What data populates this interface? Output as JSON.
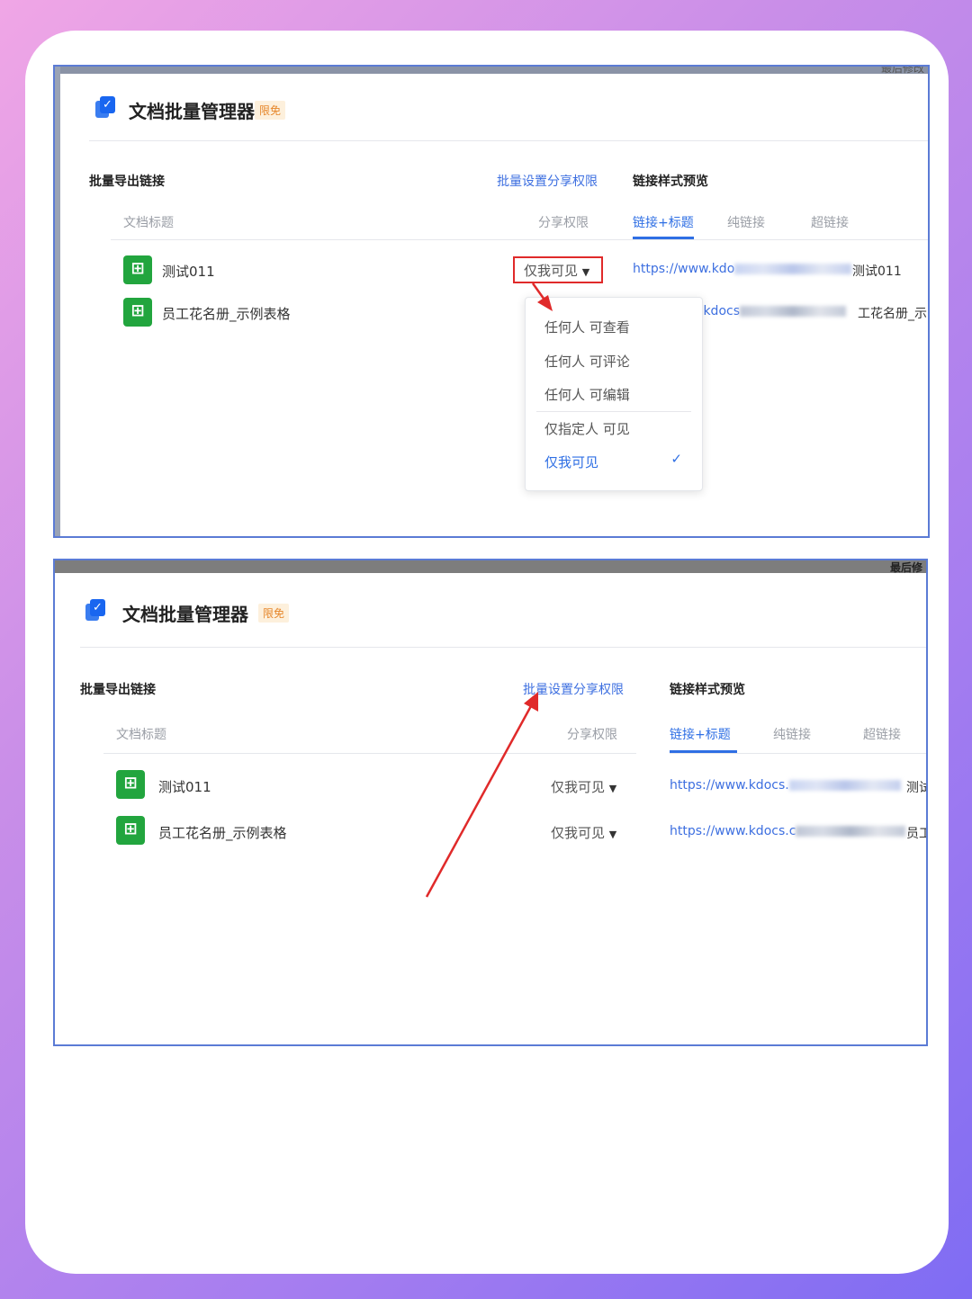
{
  "panels": [
    {
      "strip_text": "最后修改",
      "app_title": "文档批量管理器",
      "badge": "限免",
      "section_title": "批量导出链接",
      "batch_link": "批量设置分享权限",
      "preview_title": "链接样式预览",
      "col_title": "文档标题",
      "col_perm": "分享权限",
      "tabs": [
        "链接+标题",
        "纯链接",
        "超链接"
      ],
      "rows": [
        {
          "name": "测试011",
          "perm": "仅我可见",
          "url": "https://www.kdo",
          "tail": "测试011"
        },
        {
          "name": "员工花名册_示例表格",
          "url": ".kdocs",
          "tail": "工花名册_示"
        }
      ],
      "menu": {
        "items": [
          "任何人 可查看",
          "任何人 可评论",
          "任何人 可编辑",
          "仅指定人 可见",
          "仅我可见"
        ],
        "selected": "仅我可见"
      }
    },
    {
      "strip_text": "最后修",
      "app_title": "文档批量管理器",
      "badge": "限免",
      "section_title": "批量导出链接",
      "batch_link": "批量设置分享权限",
      "preview_title": "链接样式预览",
      "col_title": "文档标题",
      "col_perm": "分享权限",
      "tabs": [
        "链接+标题",
        "纯链接",
        "超链接"
      ],
      "rows": [
        {
          "name": "测试011",
          "perm": "仅我可见",
          "url": "https://www.kdocs.",
          "tail": "测试"
        },
        {
          "name": "员工花名册_示例表格",
          "perm": "仅我可见",
          "url": "https://www.kdocs.c",
          "tail": "员工"
        }
      ]
    }
  ],
  "icons": {
    "logo": "checkbox-doc-icon",
    "sheet": "spreadsheet-icon",
    "caret": "caret-down-icon",
    "check": "check-icon"
  },
  "colors": {
    "accent": "#2f6fe4",
    "annotation_red": "#e02a2a",
    "sheet_green": "#22a53e",
    "badge_orange": "#e6862a"
  }
}
